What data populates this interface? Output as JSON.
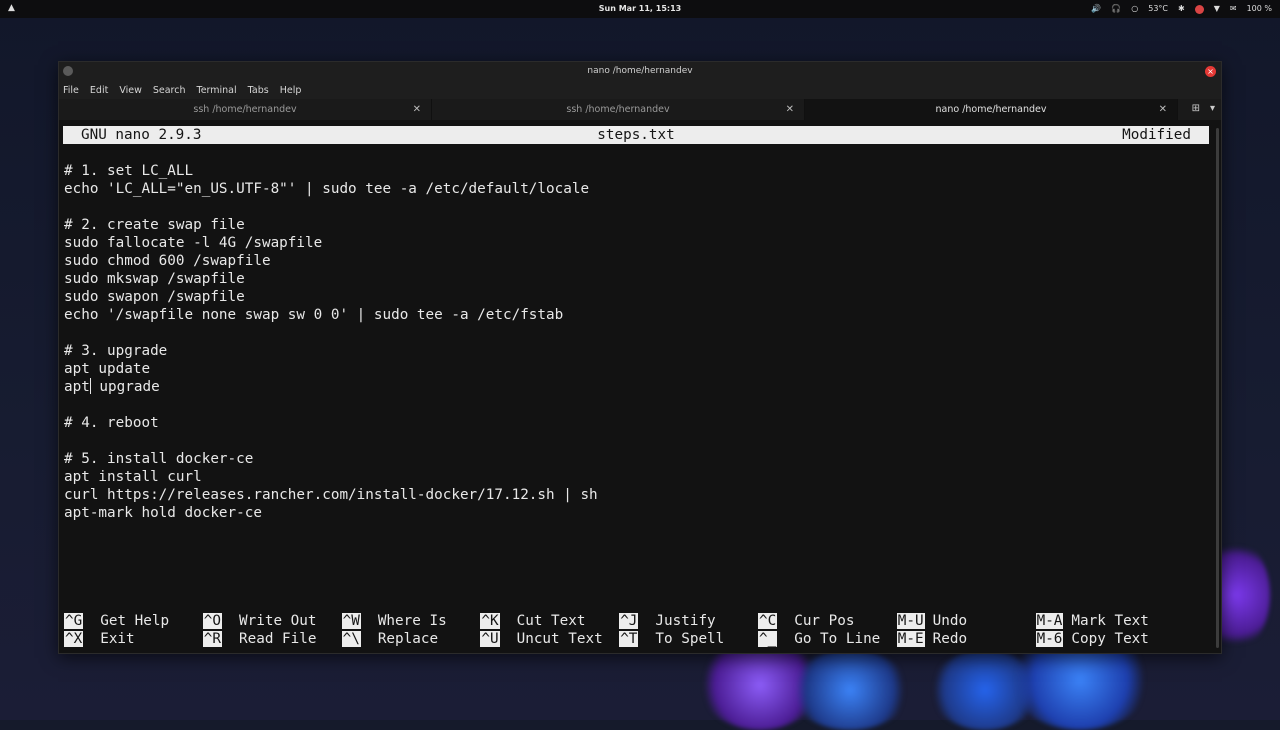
{
  "panel": {
    "apps_icon": "applications-icon",
    "clock": "Sun Mar 11, 15:13",
    "temperature": "53°C",
    "battery": "100 %"
  },
  "window": {
    "title": "nano /home/hernandev",
    "menu": [
      "File",
      "Edit",
      "View",
      "Search",
      "Terminal",
      "Tabs",
      "Help"
    ],
    "tabs": [
      {
        "label": "ssh /home/hernandev",
        "active": false
      },
      {
        "label": "ssh /home/hernandev",
        "active": false
      },
      {
        "label": "nano /home/hernandev",
        "active": true
      }
    ]
  },
  "nano": {
    "version": "GNU nano 2.9.3",
    "filename": "steps.txt",
    "status": "Modified",
    "lines": [
      "# 1. set LC_ALL",
      "echo 'LC_ALL=\"en_US.UTF-8\"' | sudo tee -a /etc/default/locale",
      "",
      "# 2. create swap file",
      "sudo fallocate -l 4G /swapfile",
      "sudo chmod 600 /swapfile",
      "sudo mkswap /swapfile",
      "sudo swapon /swapfile",
      "echo '/swapfile none swap sw 0 0' | sudo tee -a /etc/fstab",
      "",
      "# 3. upgrade",
      "apt update",
      "apt upgrade",
      "",
      "# 4. reboot",
      "",
      "# 5. install docker-ce",
      "apt install curl",
      "curl https://releases.rancher.com/install-docker/17.12.sh | sh",
      "apt-mark hold docker-ce"
    ],
    "cursor": {
      "line": 13,
      "col": 4
    },
    "shortcuts_row1": [
      {
        "key": "^G",
        "label": "Get Help"
      },
      {
        "key": "^O",
        "label": "Write Out"
      },
      {
        "key": "^W",
        "label": "Where Is"
      },
      {
        "key": "^K",
        "label": "Cut Text"
      },
      {
        "key": "^J",
        "label": "Justify"
      },
      {
        "key": "^C",
        "label": "Cur Pos"
      },
      {
        "key": "M-U",
        "label": "Undo"
      },
      {
        "key": "M-A",
        "label": "Mark Text"
      }
    ],
    "shortcuts_row2": [
      {
        "key": "^X",
        "label": "Exit"
      },
      {
        "key": "^R",
        "label": "Read File"
      },
      {
        "key": "^\\",
        "label": "Replace"
      },
      {
        "key": "^U",
        "label": "Uncut Text"
      },
      {
        "key": "^T",
        "label": "To Spell"
      },
      {
        "key": "^_",
        "label": "Go To Line"
      },
      {
        "key": "M-E",
        "label": "Redo"
      },
      {
        "key": "M-6",
        "label": "Copy Text"
      }
    ]
  }
}
